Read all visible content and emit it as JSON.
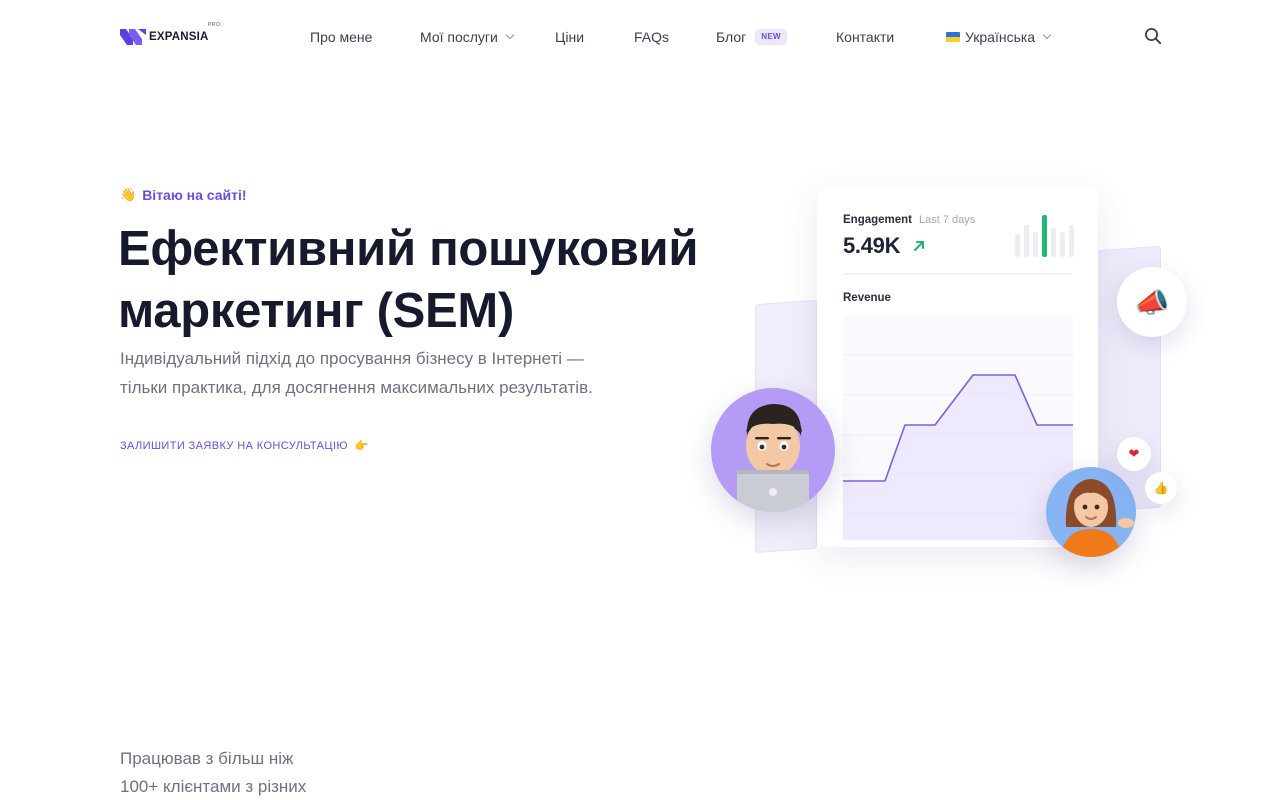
{
  "brand": {
    "name": "EXPANSIA",
    "tag": "PRO",
    "color": "#5b3fe0"
  },
  "nav": {
    "about": "Про мене",
    "services": "Мої послуги",
    "prices": "Ціни",
    "faqs": "FAQs",
    "blog": "Блог",
    "blog_badge": "NEW",
    "contacts": "Контакти",
    "language": "Українська"
  },
  "icons": {
    "search": "search-icon",
    "services_dropdown": "chevron-down-icon",
    "language_dropdown": "chevron-down-icon",
    "flag": "ukraine-flag-icon"
  },
  "hero": {
    "greeting_emoji": "👋",
    "greeting": "Вітаю на сайті!",
    "title_line1": "Ефективний пошуковий",
    "title_line2": "маркетинг (SEM)",
    "subtitle_line1": "Індивідуальний підхід до просування бізнесу в Інтернеті —",
    "subtitle_line2": "тільки практика, для досягнення максимальних результатів.",
    "cta": "ЗАЛИШИТИ ЗАЯВКУ НА КОНСУЛЬТАЦІЮ",
    "cta_emoji": "👉"
  },
  "card": {
    "engagement_label": "Engagement",
    "engagement_period": "Last 7 days",
    "engagement_value": "5.49K",
    "engagement_trend": "up",
    "revenue_label": "Revenue",
    "engagement_bars": [
      0.55,
      0.75,
      0.6,
      1.0,
      0.7,
      0.6,
      0.75
    ],
    "revenue_levels": [
      0.22,
      0.22,
      0.5,
      0.5,
      0.75,
      0.75,
      0.5,
      0.5
    ]
  },
  "decor": {
    "megaphone": "📣",
    "heart": "❤",
    "like": "👍"
  },
  "colors": {
    "accent": "#6b4fd8",
    "trend_up": "#1fb37a",
    "highlight_bar": "#22b573"
  },
  "bottom": {
    "line1": "Працював з більш ніж",
    "line2": "100+ клієнтами з різних"
  }
}
